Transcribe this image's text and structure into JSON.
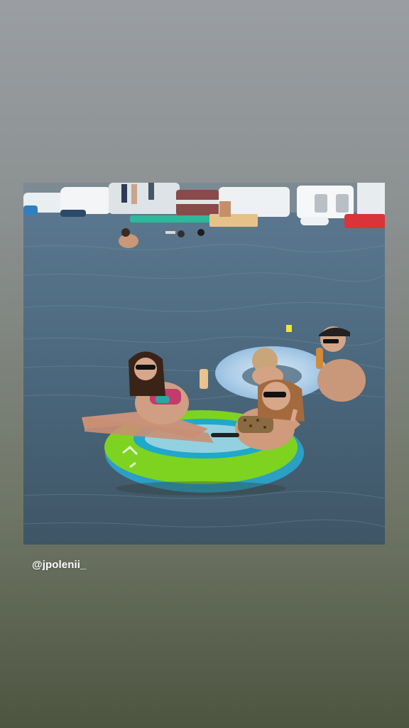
{
  "story": {
    "mention_sticker": "@jpolenii_",
    "photo_subject": "photo"
  },
  "colors": {
    "background_top": "#9a9ea3",
    "background_bottom": "#4d5440",
    "water": "#4f6a80",
    "float_green": "#7ed321",
    "float_pattern": "#1fa8c9"
  }
}
